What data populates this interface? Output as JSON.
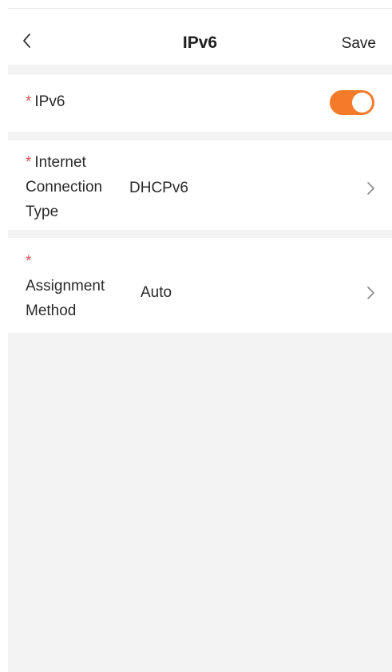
{
  "header": {
    "title": "IPv6",
    "save_label": "Save"
  },
  "rows": {
    "ipv6": {
      "required_mark": "*",
      "label": "IPv6",
      "toggle_on": true
    },
    "connection": {
      "required_mark": "*",
      "label_line1": "Internet",
      "label_line2": "Connection",
      "label_line3": "Type",
      "value": "DHCPv6"
    },
    "assignment": {
      "required_mark": "*",
      "label_line1": "Assignment",
      "label_line2": "Method",
      "value": "Auto"
    }
  },
  "colors": {
    "accent": "#f47b2a",
    "required": "#d9534f",
    "background": "#f3f3f3"
  },
  "icons": {
    "back": "chevron-left-icon",
    "row_arrow": "chevron-right-icon"
  }
}
